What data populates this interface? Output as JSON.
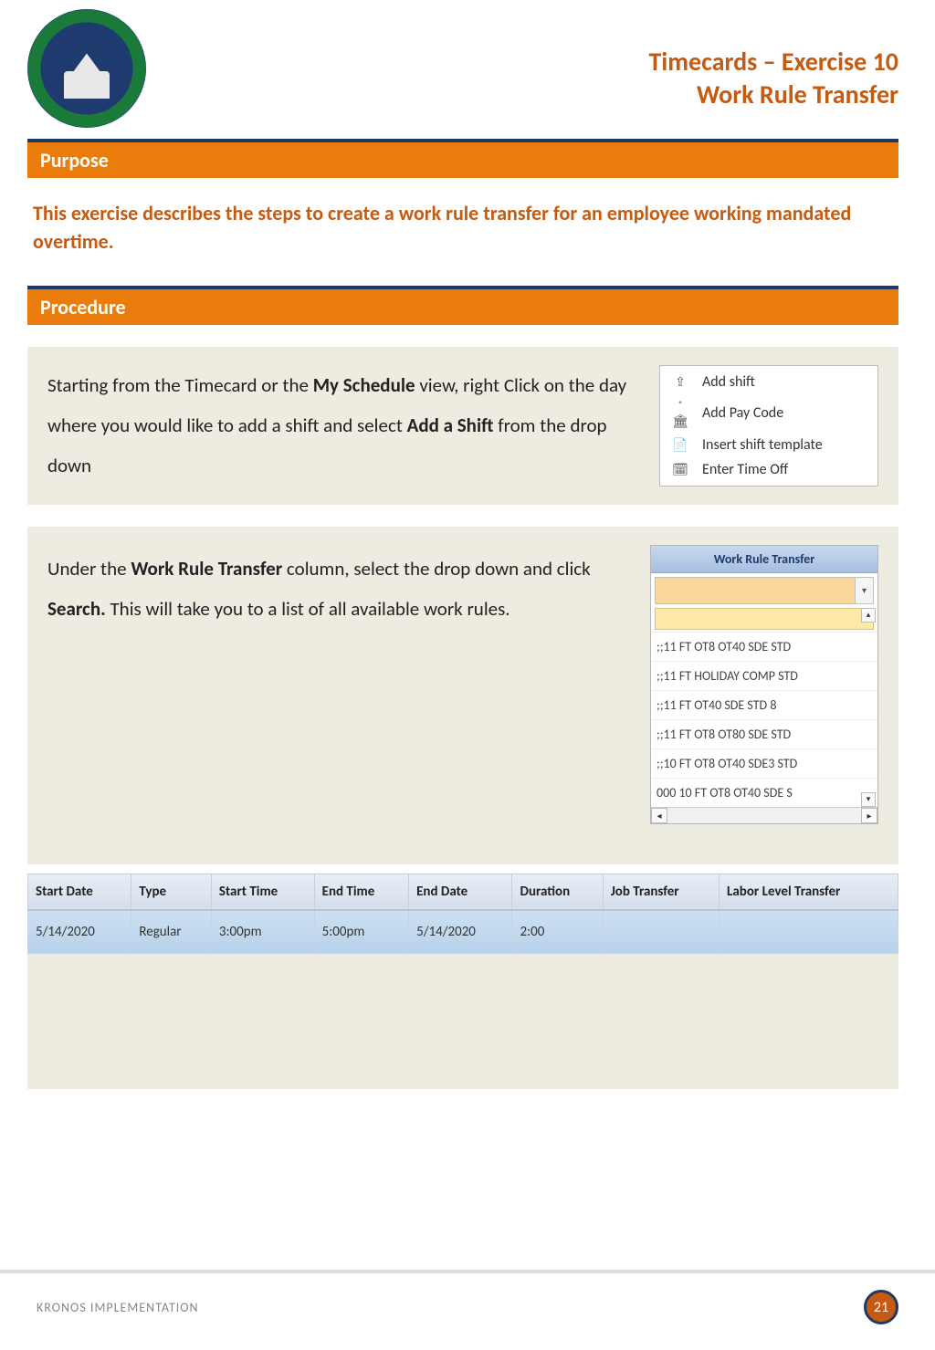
{
  "header": {
    "title_line1": "Timecards – Exercise 10",
    "title_line2": "Work Rule Transfer"
  },
  "sections": {
    "purpose_label": "Purpose",
    "procedure_label": "Procedure"
  },
  "purpose_text": "This exercise describes the steps to create a work rule transfer for an employee working mandated overtime.",
  "step1": {
    "pre1": "Starting from the Timecard or the ",
    "bold1": "My Schedule",
    "post1": " view, right Click on the day where you would like to add a shift and select ",
    "bold2": "Add a Shift",
    "post2": " from the drop down"
  },
  "context_menu": [
    {
      "label": "Add shift"
    },
    {
      "label": "Add Pay Code"
    },
    {
      "label": "Insert shift template"
    },
    {
      "label": "Enter Time Off"
    }
  ],
  "step2": {
    "pre1": "Under the ",
    "bold1": "Work Rule Transfer",
    "mid1": " column, select the drop down and click ",
    "bold2": "Search.",
    "post2": " This will take you to a list of all available work rules."
  },
  "dropdown": {
    "header": "Work Rule Transfer",
    "options": [
      ";;11 FT OT8 OT40 SDE STD",
      ";;11 FT HOLIDAY COMP STD",
      ";;11 FT OT40 SDE STD 8",
      ";;11 FT OT8 OT80 SDE STD",
      ";;10 FT OT8 OT40 SDE3 STD",
      "000 10 FT OT8 OT40 SDE S"
    ]
  },
  "table": {
    "headers": [
      "Start Date",
      "Type",
      "Start Time",
      "End Time",
      "End Date",
      "Duration",
      "Job Transfer",
      "Labor Level Transfer"
    ],
    "row": [
      "5/14/2020",
      "Regular",
      "3:00pm",
      "5:00pm",
      "5/14/2020",
      "2:00",
      "",
      ""
    ]
  },
  "footer": {
    "text": "KRONOS IMPLEMENTATION",
    "page": "21"
  }
}
